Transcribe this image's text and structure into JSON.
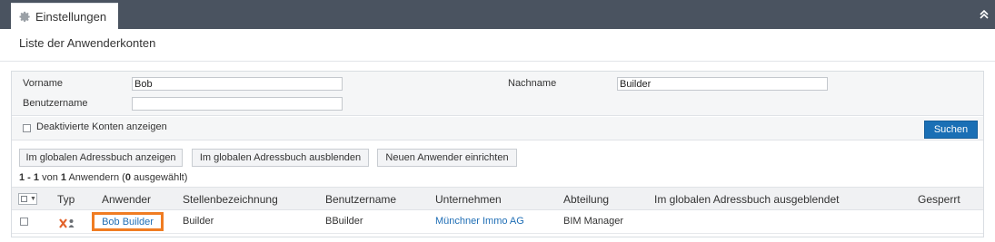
{
  "tab": {
    "label": "Einstellungen"
  },
  "page": {
    "title": "Liste der Anwenderkonten"
  },
  "filter": {
    "firstname_label": "Vorname",
    "firstname_value": "Bob",
    "lastname_label": "Nachname",
    "lastname_value": "Builder",
    "username_label": "Benutzername",
    "username_value": "",
    "deactivated_label": "Deaktivierte Konten anzeigen",
    "search_label": "Suchen"
  },
  "actions": {
    "show_global": "Im globalen Adressbuch anzeigen",
    "hide_global": "Im globalen Adressbuch ausblenden",
    "new_user": "Neuen Anwender einrichten"
  },
  "count": {
    "range": "1 - 1",
    "of": "von",
    "total": "1",
    "unit": "Anwendern",
    "selected": "0",
    "selected_label": "ausgewählt"
  },
  "table": {
    "headers": [
      "Typ",
      "Anwender",
      "Stellenbezeichnung",
      "Benutzername",
      "Unternehmen",
      "Abteilung",
      "Im globalen Adressbuch ausgeblendet",
      "Gesperrt"
    ],
    "rows": [
      {
        "anwender": "Bob Builder",
        "stellenbezeichnung": "Builder",
        "benutzername": "BBuilder",
        "unternehmen": "Münchner Immo AG",
        "abteilung": "BIM Manager",
        "ausgeblendet": "",
        "gesperrt": ""
      }
    ]
  },
  "colors": {
    "topbar": "#4a5360",
    "primary": "#1a6fb5",
    "highlight": "#f07c22",
    "link": "#1f6eb5"
  }
}
